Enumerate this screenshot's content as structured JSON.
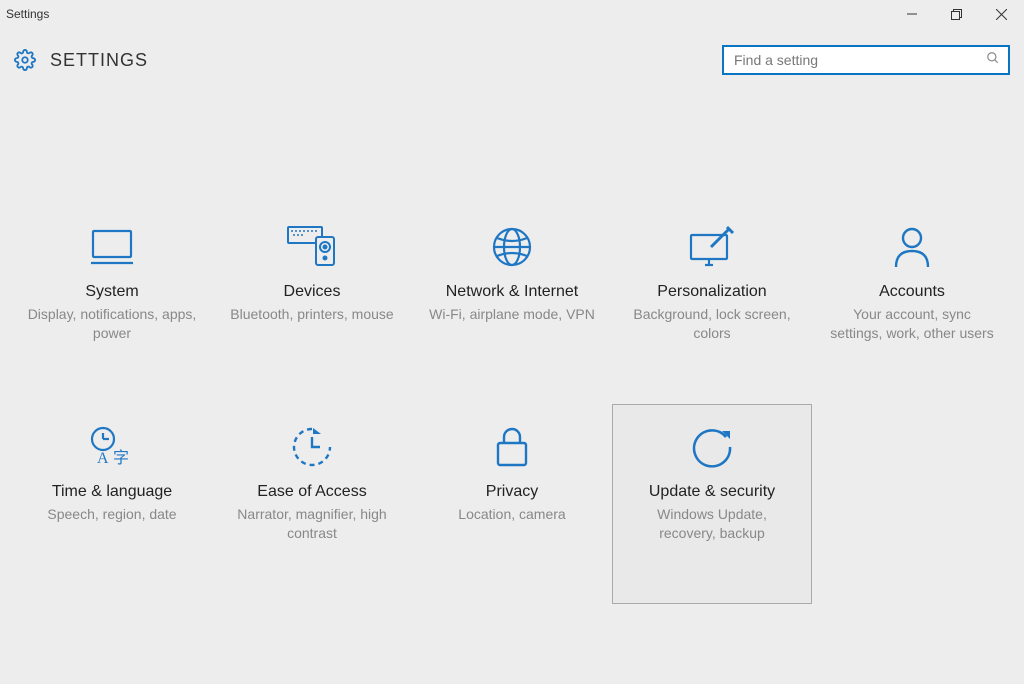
{
  "window": {
    "title": "Settings"
  },
  "header": {
    "title": "SETTINGS"
  },
  "search": {
    "placeholder": "Find a setting"
  },
  "tiles": [
    {
      "label": "System",
      "desc": "Display, notifications, apps, power"
    },
    {
      "label": "Devices",
      "desc": "Bluetooth, printers, mouse"
    },
    {
      "label": "Network & Internet",
      "desc": "Wi-Fi, airplane mode, VPN"
    },
    {
      "label": "Personalization",
      "desc": "Background, lock screen, colors"
    },
    {
      "label": "Accounts",
      "desc": "Your account, sync settings, work, other users"
    },
    {
      "label": "Time & language",
      "desc": "Speech, region, date"
    },
    {
      "label": "Ease of Access",
      "desc": "Narrator, magnifier, high contrast"
    },
    {
      "label": "Privacy",
      "desc": "Location, camera"
    },
    {
      "label": "Update & security",
      "desc": "Windows Update, recovery, backup"
    }
  ],
  "colors": {
    "accent": "#1f77c4",
    "searchBorder": "#0a75c2"
  }
}
